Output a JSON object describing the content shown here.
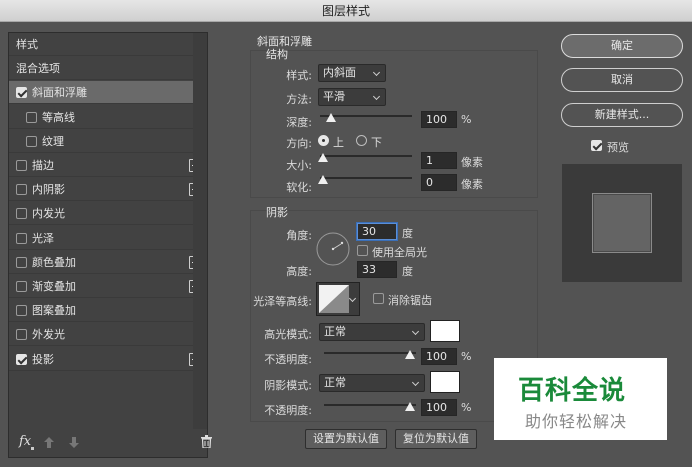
{
  "window": {
    "title": "图层样式"
  },
  "left_panel": {
    "items": [
      {
        "label": "样式",
        "checkbox": false,
        "checked": false,
        "plus": false,
        "selected": false,
        "indent": 0
      },
      {
        "label": "混合选项",
        "checkbox": false,
        "checked": false,
        "plus": false,
        "selected": false,
        "indent": 0
      },
      {
        "label": "斜面和浮雕",
        "checkbox": true,
        "checked": true,
        "plus": false,
        "selected": true,
        "indent": 0
      },
      {
        "label": "等高线",
        "checkbox": true,
        "checked": false,
        "plus": false,
        "selected": false,
        "indent": 1
      },
      {
        "label": "纹理",
        "checkbox": true,
        "checked": false,
        "plus": false,
        "selected": false,
        "indent": 1
      },
      {
        "label": "描边",
        "checkbox": true,
        "checked": false,
        "plus": true,
        "selected": false,
        "indent": 0
      },
      {
        "label": "内阴影",
        "checkbox": true,
        "checked": false,
        "plus": true,
        "selected": false,
        "indent": 0
      },
      {
        "label": "内发光",
        "checkbox": true,
        "checked": false,
        "plus": false,
        "selected": false,
        "indent": 0
      },
      {
        "label": "光泽",
        "checkbox": true,
        "checked": false,
        "plus": false,
        "selected": false,
        "indent": 0
      },
      {
        "label": "颜色叠加",
        "checkbox": true,
        "checked": false,
        "plus": true,
        "selected": false,
        "indent": 0
      },
      {
        "label": "渐变叠加",
        "checkbox": true,
        "checked": false,
        "plus": true,
        "selected": false,
        "indent": 0
      },
      {
        "label": "图案叠加",
        "checkbox": true,
        "checked": false,
        "plus": false,
        "selected": false,
        "indent": 0
      },
      {
        "label": "外发光",
        "checkbox": true,
        "checked": false,
        "plus": false,
        "selected": false,
        "indent": 0
      },
      {
        "label": "投影",
        "checkbox": true,
        "checked": true,
        "plus": true,
        "selected": false,
        "indent": 0
      }
    ],
    "footer": {
      "fx_label": "fx"
    }
  },
  "bevel": {
    "title": "斜面和浮雕",
    "structure": {
      "title": "结构",
      "style_label": "样式:",
      "style_value": "内斜面",
      "method_label": "方法:",
      "method_value": "平滑",
      "depth_label": "深度:",
      "depth_value": "100",
      "depth_unit": "%",
      "direction_label": "方向:",
      "dir_up": "上",
      "dir_down": "下",
      "size_label": "大小:",
      "size_value": "1",
      "size_unit": "像素",
      "soften_label": "软化:",
      "soften_value": "0",
      "soften_unit": "像素"
    },
    "shading": {
      "title": "阴影",
      "angle_label": "角度:",
      "angle_value": "30",
      "angle_unit": "度",
      "global_light_label": "使用全局光",
      "altitude_label": "高度:",
      "altitude_value": "33",
      "altitude_unit": "度",
      "gloss_label": "光泽等高线:",
      "antialias_label": "消除锯齿",
      "highlight_label": "高光模式:",
      "highlight_value": "正常",
      "highlight_color": "#ffffff",
      "opacity1_label": "不透明度:",
      "opacity1_value": "100",
      "opacity1_unit": "%",
      "shadow_label": "阴影模式:",
      "shadow_value": "正常",
      "shadow_color": "#ffffff",
      "opacity2_label": "不透明度:",
      "opacity2_value": "100",
      "opacity2_unit": "%"
    }
  },
  "bottom_buttons": {
    "make_default": "设置为默认值",
    "reset_default": "复位为默认值"
  },
  "right": {
    "ok": "确定",
    "cancel": "取消",
    "new_style": "新建样式...",
    "preview_label": "预览"
  },
  "watermark": {
    "line1": "百科全说",
    "line2": "助你轻松解决"
  }
}
